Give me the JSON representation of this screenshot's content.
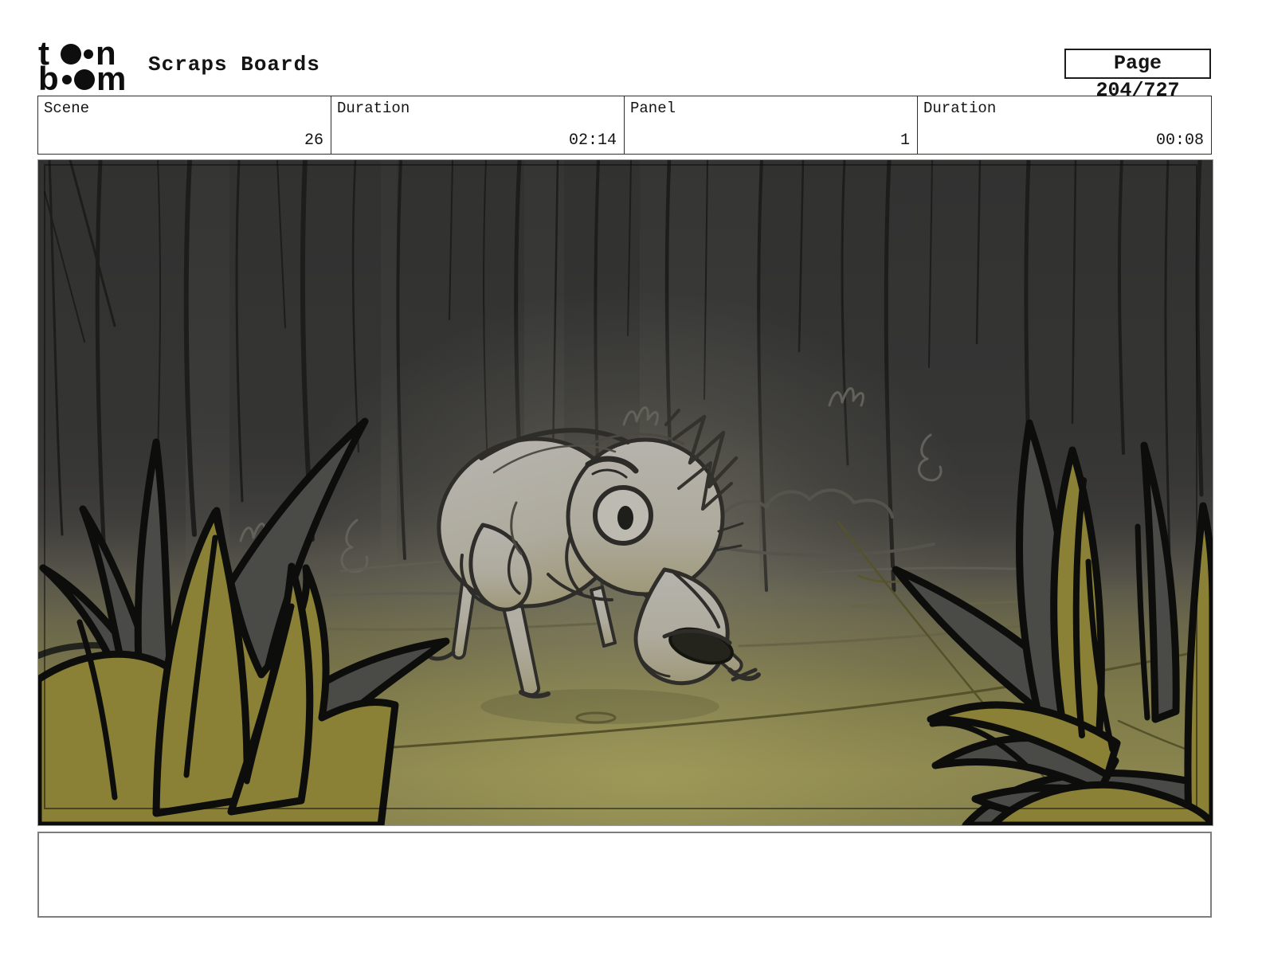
{
  "header": {
    "logo": {
      "word1_first": "t",
      "word1_last": "n",
      "word2_first": "b",
      "word2_last": "m",
      "brand": "toon boom"
    },
    "title": "Scraps Boards",
    "page_indicator": "Page 204/727"
  },
  "info_row": {
    "cells": [
      {
        "label": "Scene",
        "value": "26"
      },
      {
        "label": "Duration",
        "value": "02:14"
      },
      {
        "label": "Panel",
        "value": "1"
      },
      {
        "label": "Duration",
        "value": "00:08"
      }
    ]
  },
  "panel": {
    "description": "Sketch of a worried dog standing on a forest path at night between two large olive-green bushes, dark tree trunks behind"
  },
  "caption": {
    "text": ""
  },
  "palette": {
    "forest_dark": "#3a3a39",
    "trunk_line": "#1d1d1c",
    "ground_olive": "#8a854e",
    "path_line": "#55522b",
    "bush_olive": "#8a8136",
    "bush_gray": "#4a4a47",
    "bush_outline": "#0d0d0c",
    "dog_gray": "#b4b1ab",
    "dog_outline": "#2e2d29"
  }
}
